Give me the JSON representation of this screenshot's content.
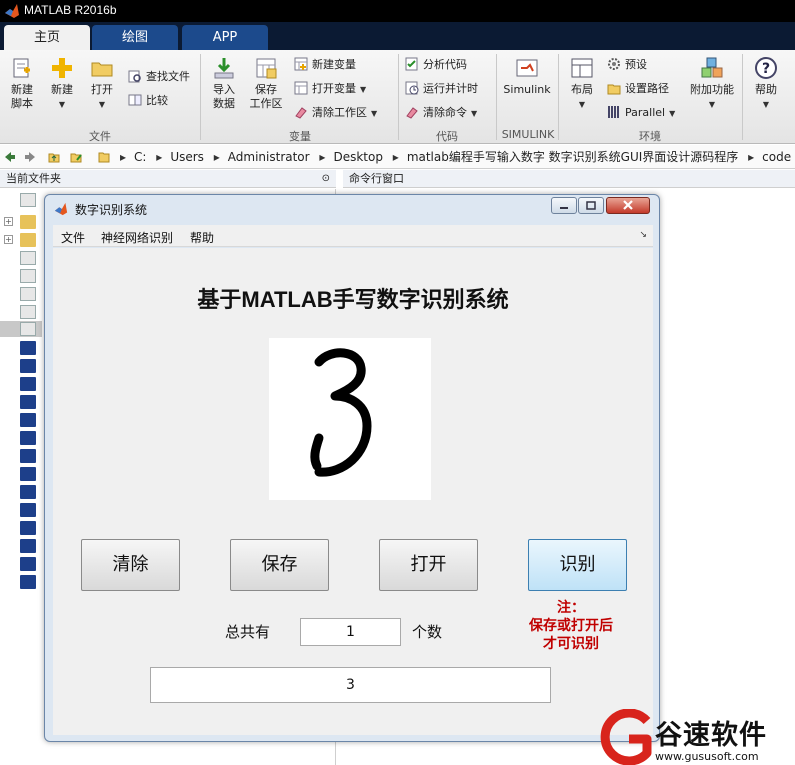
{
  "app": {
    "title": "MATLAB R2016b"
  },
  "tabs": [
    {
      "label": "主页",
      "active": true
    },
    {
      "label": "绘图"
    },
    {
      "label": "APP"
    }
  ],
  "ribbon": {
    "new_script": "新建\n脚本",
    "new": "新建",
    "open": "打开",
    "find_files": "查找文件",
    "compare": "比较",
    "import_data": "导入\n数据",
    "save_workspace": "保存\n工作区",
    "new_variable": "新建变量",
    "open_variable": "打开变量",
    "clear_workspace": "清除工作区",
    "analyze_code": "分析代码",
    "run_and_time": "运行并计时",
    "clear_commands": "清除命令",
    "simulink": "Simulink",
    "layout": "布局",
    "preferences": "预设",
    "set_path": "设置路径",
    "parallel": "Parallel",
    "addons": "附加功能",
    "help": "帮助",
    "groups": {
      "file": "文件",
      "variable": "变量",
      "code": "代码",
      "simulink": "SIMULINK",
      "environment": "环境"
    }
  },
  "address": {
    "crumbs": [
      "C:",
      "Users",
      "Administrator",
      "Desktop",
      "matlab编程手写输入数字 数字识别系统GUI界面设计源码程序",
      "code"
    ]
  },
  "panels": {
    "current_folder": "当前文件夹",
    "command_window": "命令行窗口"
  },
  "gui": {
    "title": "数字识别系统",
    "menus": [
      "文件",
      "神经网络识别",
      "帮助"
    ],
    "heading": "基于MATLAB手写数字识别系统",
    "buttons": {
      "clear": "清除",
      "save": "保存",
      "open": "打开",
      "recognize": "识别"
    },
    "count_label_prefix": "总共有",
    "count_value": "1",
    "count_label_suffix": "个数",
    "note_line1": "注：",
    "note_line2": "保存或打开后",
    "note_line3": "才可识别",
    "result": "3"
  },
  "watermark": {
    "text": "谷速软件",
    "url": "www.gususoft.com"
  },
  "colors": {
    "accent": "#1c4a8c",
    "note_red": "#c00000",
    "watermark_red": "#d8241c"
  }
}
